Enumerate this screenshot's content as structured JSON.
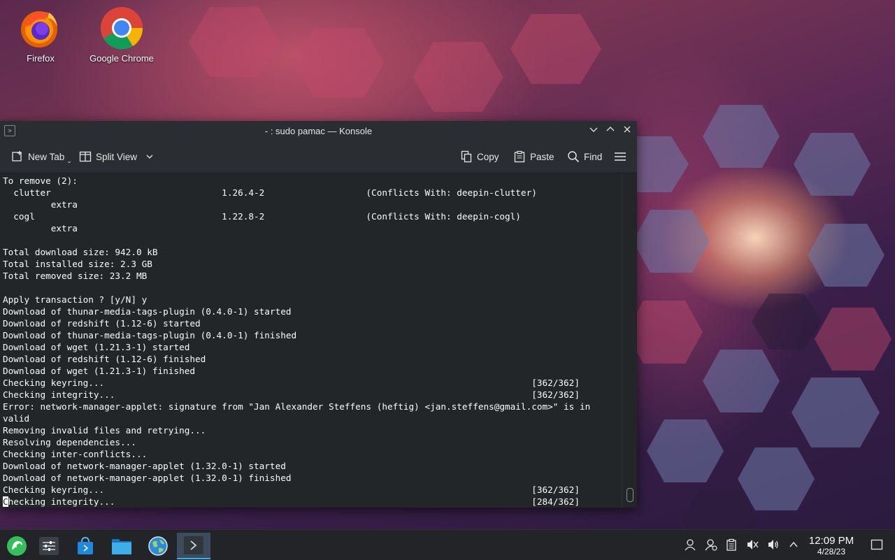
{
  "desktop": {
    "icons": [
      {
        "label": "Firefox",
        "icon": "firefox-icon"
      },
      {
        "label": "Google Chrome",
        "icon": "chrome-icon"
      }
    ]
  },
  "window": {
    "title": "- : sudo pamac — Konsole",
    "controls": {
      "minimize": "﹀",
      "maximize": "︿",
      "close": "✕"
    }
  },
  "toolbar": {
    "new_tab": "New Tab",
    "split_view": "Split View",
    "copy": "Copy",
    "paste": "Paste",
    "find": "Find"
  },
  "terminal": {
    "lines": [
      "To remove (2):",
      "  clutter                                1.26.4-2                   (Conflicts With: deepin-clutter)",
      "         extra",
      "  cogl                                   1.22.8-2                   (Conflicts With: deepin-cogl)",
      "         extra",
      "",
      "Total download size: 942.0 kB",
      "Total installed size: 2.3 GB",
      "Total removed size: 23.2 MB",
      "",
      "Apply transaction ? [y/N] y",
      "Download of thunar-media-tags-plugin (0.4.0-1) started",
      "Download of redshift (1.12-6) started",
      "Download of thunar-media-tags-plugin (0.4.0-1) finished",
      "Download of wget (1.21.3-1) started",
      "Download of redshift (1.12-6) finished",
      "Download of wget (1.21.3-1) finished",
      "Checking keyring...                                                                                [362/362]",
      "Checking integrity...                                                                              [362/362]",
      "Error: network-manager-applet: signature from \"Jan Alexander Steffens (heftig) <jan.steffens@gmail.com>\" is in",
      "valid",
      "Removing invalid files and retrying...",
      "Resolving dependencies...",
      "Checking inter-conflicts...",
      "Download of network-manager-applet (1.32.0-1) started",
      "Download of network-manager-applet (1.32.0-1) finished",
      "Checking keyring...                                                                                [362/362]"
    ],
    "last_line_cursor_char": "C",
    "last_line_rest": "hecking integrity...                                                                              [284/362]"
  },
  "taskbar": {
    "items": [
      {
        "name": "app-launcher",
        "icon": "manjaro-logo-icon"
      },
      {
        "name": "system-settings-panel",
        "icon": "sliders-icon"
      },
      {
        "name": "software-store",
        "icon": "store-bag-icon"
      },
      {
        "name": "file-manager",
        "icon": "folder-icon"
      },
      {
        "name": "browser",
        "icon": "globe-icon"
      },
      {
        "name": "konsole",
        "icon": "terminal-icon",
        "active": true
      }
    ],
    "clock": {
      "time": "12:09 PM",
      "date": "4/28/23"
    }
  },
  "colors": {
    "accent": "#3daee9",
    "terminal_bg": "#232629",
    "terminal_fg": "#fcfcfc"
  }
}
